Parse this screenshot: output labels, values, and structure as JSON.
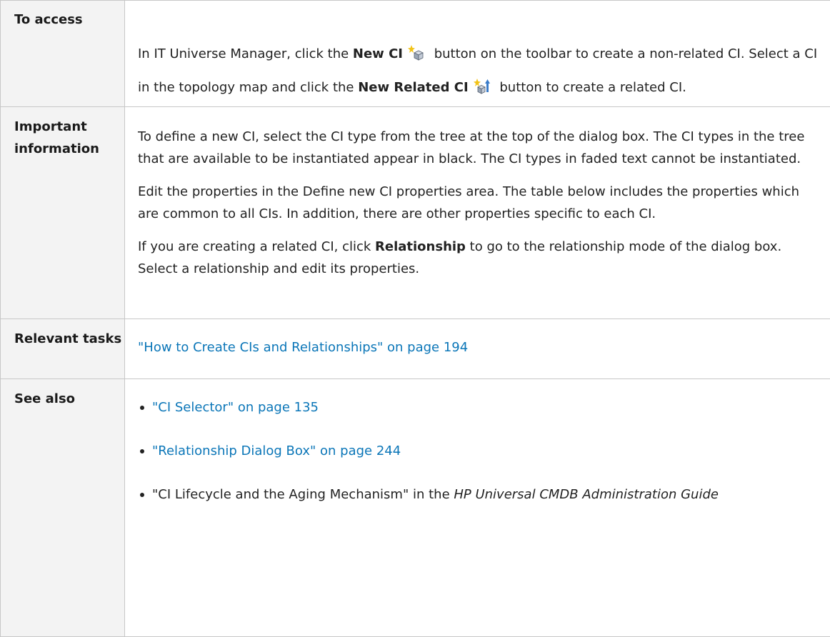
{
  "rows": {
    "access": {
      "label": "To access",
      "t1": "In IT Universe Manager, click the ",
      "b1": "New CI",
      "t2": " button on the toolbar to create a non-related CI. Select a CI in the topology map and click the ",
      "b2": "New Related CI",
      "t3": " button to create a related CI.",
      "icon1": "new-ci-icon",
      "icon2": "new-related-ci-icon"
    },
    "important": {
      "label": "Important information",
      "p1": "To define a new CI, select the CI type from the tree at the top of the dialog box. The CI types in the tree that are available to be instantiated appear in black. The CI types in faded text cannot be instantiated.",
      "p2": "Edit the properties in the Define new CI properties area. The table below includes the properties which are common to all CIs. In addition, there are other properties specific to each CI.",
      "p3a": "If you are creating a related CI, click ",
      "p3b": "Relationship",
      "p3c": " to go to the relationship mode of the dialog box. Select a relationship and edit its properties."
    },
    "tasks": {
      "label": "Relevant tasks",
      "link": "\"How to Create CIs and Relationships\" on page 194"
    },
    "see_also": {
      "label": "See also",
      "items": [
        {
          "link": "\"CI Selector\" on page 135"
        },
        {
          "link": "\"Relationship Dialog Box\" on page 244"
        }
      ],
      "item3_text": "\"CI Lifecycle and the Aging Mechanism\" in the ",
      "item3_italic": "HP Universal CMDB Administration Guide"
    }
  },
  "colors": {
    "link": "#0b76b8",
    "label_bg": "#f3f3f3",
    "border": "#c7c7c7"
  }
}
